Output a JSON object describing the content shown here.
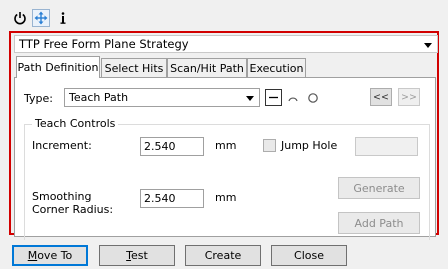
{
  "toolbar": {
    "icons": [
      "power-icon",
      "move-arrows-icon",
      "info-icon"
    ],
    "active_index": 1
  },
  "strategy": {
    "selected": "TTP Free Form Plane Strategy"
  },
  "tabs": [
    {
      "label": "Path Definition",
      "active": true
    },
    {
      "label": "Select Hits",
      "active": false
    },
    {
      "label": "Scan/Hit Path",
      "active": false
    },
    {
      "label": "Execution",
      "active": false
    }
  ],
  "path_definition": {
    "type_label": "Type:",
    "type_value": "Teach Path",
    "path_shapes": [
      "line-shape-icon",
      "arc-shape-icon",
      "circle-shape-icon"
    ],
    "prev_label": "<<",
    "next_label": ">>",
    "teach_controls": {
      "title": "Teach Controls",
      "increment_label": "Increment:",
      "increment_value": "2.540",
      "increment_unit": "mm",
      "jump_hole_label": "Jump Hole",
      "jump_hole_checked": false,
      "jump_hole_value": "",
      "smoothing_label_line1": "Smoothing",
      "smoothing_label_line2": "Corner Radius:",
      "smoothing_value": "2.540",
      "smoothing_unit": "mm",
      "generate_label": "Generate",
      "add_path_label": "Add Path"
    }
  },
  "footer": {
    "move_to_first": "M",
    "move_to_rest": "ove To",
    "test_first": "T",
    "test_rest": "est",
    "create_label": "Create",
    "close_label": "Close"
  }
}
